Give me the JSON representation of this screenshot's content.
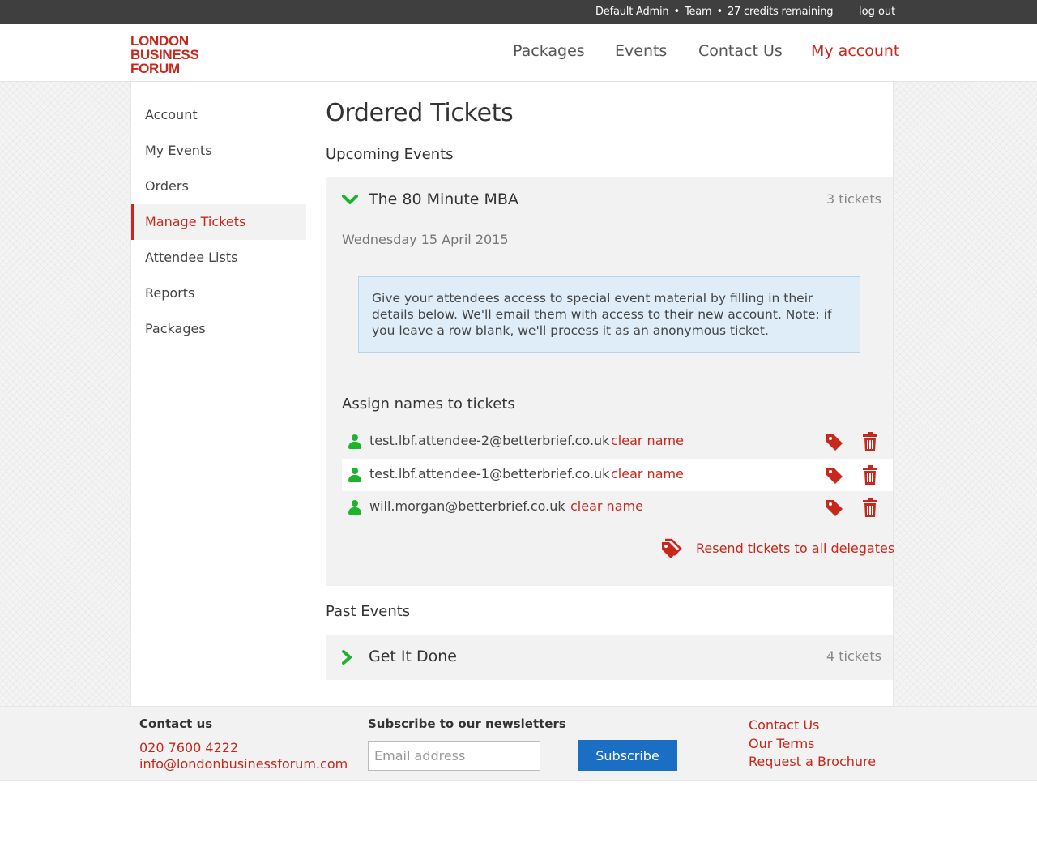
{
  "topbar": {
    "user": "Default Admin",
    "team": "Team",
    "credits": "27 credits remaining",
    "logout": "log out"
  },
  "logo": {
    "line1": "LONDON",
    "line2": "BUSINESS",
    "line3": "FORUM"
  },
  "nav": {
    "packages": "Packages",
    "events": "Events",
    "contact": "Contact Us",
    "account": "My account"
  },
  "sidebar": {
    "items": [
      {
        "label": "Account"
      },
      {
        "label": "My Events"
      },
      {
        "label": "Orders"
      },
      {
        "label": "Manage Tickets"
      },
      {
        "label": "Attendee Lists"
      },
      {
        "label": "Reports"
      },
      {
        "label": "Packages"
      }
    ]
  },
  "main": {
    "title": "Ordered Tickets",
    "upcoming_title": "Upcoming Events",
    "upcoming_event": {
      "name": "The 80 Minute MBA",
      "tickets": "3 tickets",
      "date": "Wednesday 15 April 2015",
      "notice": "Give your attendees access to special event material by filling in their details below. We'll email them with access to their new account. Note: if you leave a row blank, we'll process it as an anonymous ticket.",
      "assign_title": "Assign names to tickets",
      "attendees": [
        {
          "email": "test.lbf.attendee-2@betterbrief.co.uk",
          "clear": "clear name"
        },
        {
          "email": "test.lbf.attendee-1@betterbrief.co.uk",
          "clear": "clear name"
        },
        {
          "email": "will.morgan@betterbrief.co.uk",
          "clear": "clear name"
        }
      ],
      "resend": "Resend tickets to all delegates"
    },
    "past_title": "Past Events",
    "past_event": {
      "name": "Get It Done",
      "tickets": "4 tickets"
    }
  },
  "footer": {
    "contact_title": "Contact us",
    "phone": "020 7600 4222",
    "email": "info@londonbusinessforum.com",
    "newsletter_title": "Subscribe to our newsletters",
    "email_placeholder": "Email address",
    "subscribe": "Subscribe",
    "links": {
      "contact": "Contact Us",
      "terms": "Our Terms",
      "brochure": "Request a Brochure"
    }
  },
  "colors": {
    "brand_red": "#c8271b",
    "success_green": "#1db32d",
    "button_blue": "#1a6fc4"
  },
  "icons": {
    "expanded": "chevron-down-icon",
    "collapsed": "chevron-right-icon",
    "user": "user-icon",
    "tag": "tag-icon",
    "trash": "trash-icon",
    "tags": "tags-icon"
  }
}
